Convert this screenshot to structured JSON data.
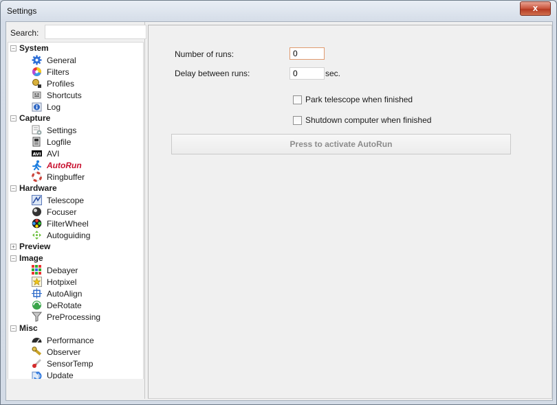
{
  "window": {
    "title": "Settings",
    "close_glyph": "x"
  },
  "search": {
    "label": "Search:",
    "value": "",
    "placeholder": ""
  },
  "tree": [
    {
      "group": "System",
      "expander": "−",
      "items": [
        {
          "label": "General",
          "icon": "gear-icon"
        },
        {
          "label": "Filters",
          "icon": "color-wheel-icon"
        },
        {
          "label": "Profiles",
          "icon": "profiles-icon"
        },
        {
          "label": "Shortcuts",
          "icon": "shortcuts-icon"
        },
        {
          "label": "Log",
          "icon": "info-icon"
        }
      ]
    },
    {
      "group": "Capture",
      "expander": "−",
      "items": [
        {
          "label": "Settings",
          "icon": "capture-settings-icon"
        },
        {
          "label": "Logfile",
          "icon": "logfile-icon"
        },
        {
          "label": "AVI",
          "icon": "avi-icon"
        },
        {
          "label": "AutoRun",
          "icon": "running-man-icon",
          "active": true
        },
        {
          "label": "Ringbuffer",
          "icon": "lifebuoy-icon"
        }
      ]
    },
    {
      "group": "Hardware",
      "expander": "−",
      "items": [
        {
          "label": "Telescope",
          "icon": "telescope-icon"
        },
        {
          "label": "Focuser",
          "icon": "focuser-icon"
        },
        {
          "label": "FilterWheel",
          "icon": "filterwheel-icon"
        },
        {
          "label": "Autoguiding",
          "icon": "autoguiding-icon"
        }
      ]
    },
    {
      "group": "Preview",
      "expander": "+",
      "items": []
    },
    {
      "group": "Image",
      "expander": "−",
      "items": [
        {
          "label": "Debayer",
          "icon": "debayer-grid-icon"
        },
        {
          "label": "Hotpixel",
          "icon": "hotpixel-icon"
        },
        {
          "label": "AutoAlign",
          "icon": "autoalign-icon"
        },
        {
          "label": "DeRotate",
          "icon": "derotate-icon"
        },
        {
          "label": "PreProcessing",
          "icon": "funnel-icon"
        }
      ]
    },
    {
      "group": "Misc",
      "expander": "−",
      "items": [
        {
          "label": "Performance",
          "icon": "gauge-icon"
        },
        {
          "label": "Observer",
          "icon": "observer-icon"
        },
        {
          "label": "SensorTemp",
          "icon": "thermometer-icon"
        },
        {
          "label": "Update",
          "icon": "update-icon"
        }
      ]
    }
  ],
  "autorun": {
    "runs_label": "Number of runs:",
    "runs_value": "0",
    "delay_label": "Delay between runs:",
    "delay_value": "0",
    "delay_unit": "sec.",
    "park_label": "Park telescope when finished",
    "park_checked": false,
    "shutdown_label": "Shutdown computer when finished",
    "shutdown_checked": false,
    "activate_label": "Press to activate AutoRun"
  }
}
